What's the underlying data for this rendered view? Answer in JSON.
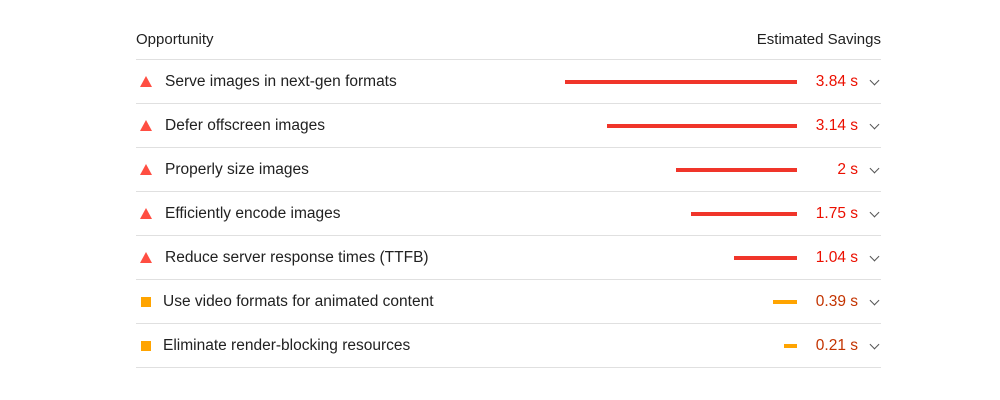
{
  "header": {
    "opportunity_label": "Opportunity",
    "savings_label": "Estimated Savings"
  },
  "colors": {
    "fail": "#eb0f00",
    "average": "#ffa400",
    "average_text": "#c33300"
  },
  "max_savings_seconds": 3.84,
  "items": [
    {
      "title": "Serve images in next-gen formats",
      "savings": "3.84 s",
      "seconds": 3.84,
      "severity": "fail",
      "icon": "red-triangle-icon"
    },
    {
      "title": "Defer offscreen images",
      "savings": "3.14 s",
      "seconds": 3.14,
      "severity": "fail",
      "icon": "red-triangle-icon"
    },
    {
      "title": "Properly size images",
      "savings": "2 s",
      "seconds": 2.0,
      "severity": "fail",
      "icon": "red-triangle-icon"
    },
    {
      "title": "Efficiently encode images",
      "savings": "1.75 s",
      "seconds": 1.75,
      "severity": "fail",
      "icon": "red-triangle-icon"
    },
    {
      "title": "Reduce server response times (TTFB)",
      "savings": "1.04 s",
      "seconds": 1.04,
      "severity": "fail",
      "icon": "red-triangle-icon"
    },
    {
      "title": "Use video formats for animated content",
      "savings": "0.39 s",
      "seconds": 0.39,
      "severity": "average",
      "icon": "orange-square-icon"
    },
    {
      "title": "Eliminate render-blocking resources",
      "savings": "0.21 s",
      "seconds": 0.21,
      "severity": "average",
      "icon": "orange-square-icon"
    }
  ]
}
